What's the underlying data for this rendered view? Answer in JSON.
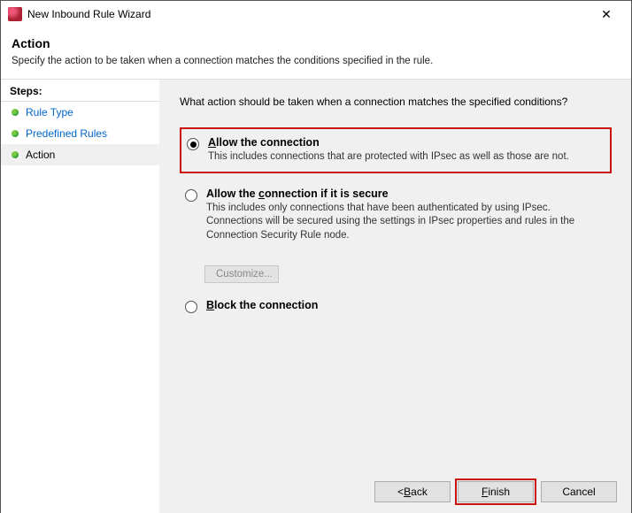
{
  "window": {
    "title": "New Inbound Rule Wizard"
  },
  "header": {
    "heading": "Action",
    "subheading": "Specify the action to be taken when a connection matches the conditions specified in the rule."
  },
  "sidebar": {
    "steps_label": "Steps:",
    "items": [
      {
        "label": "Rule Type"
      },
      {
        "label": "Predefined Rules"
      },
      {
        "label": "Action"
      }
    ]
  },
  "content": {
    "prompt": "What action should be taken when a connection matches the specified conditions?",
    "options": [
      {
        "mnemonic": "A",
        "title_rest": "llow the connection",
        "desc": "This includes connections that are protected with IPsec as well as those are not."
      },
      {
        "mnemonic": "",
        "title_rest": "Allow the ",
        "mnemonic2": "c",
        "title_rest2": "onnection if it is secure",
        "desc": "This includes only connections that have been authenticated by using IPsec.  Connections will be secured using the settings in IPsec properties and rules in the Connection Security Rule node."
      },
      {
        "mnemonic": "B",
        "title_rest": "lock the connection",
        "desc": ""
      }
    ],
    "customize_label": "Customize..."
  },
  "footer": {
    "back": "ack",
    "back_m": "B",
    "back_prefix": "< ",
    "finish": "inish",
    "finish_m": "F",
    "cancel": "Cancel"
  }
}
